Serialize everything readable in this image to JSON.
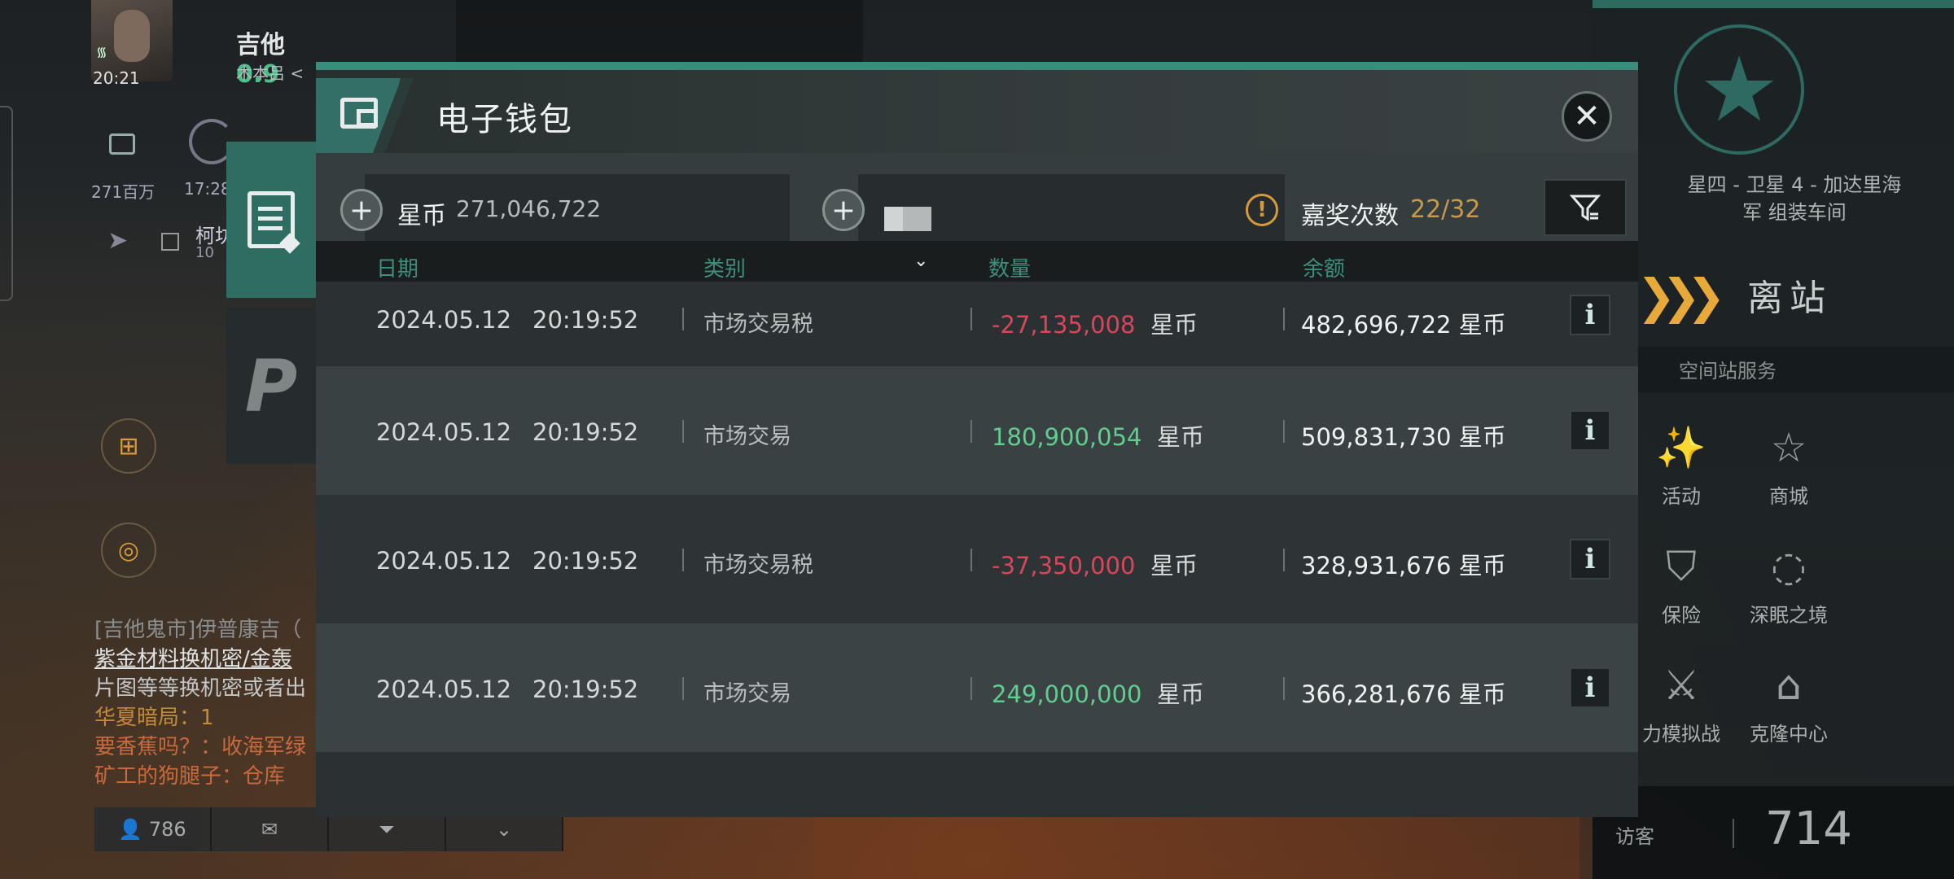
{
  "player": {
    "clock": "20:21",
    "name": "吉他",
    "security": "0.9",
    "corp": "木本吕 <",
    "isk_short": "271百万",
    "time_short": "17:28",
    "location_short": "柯坊",
    "location_sub": "10"
  },
  "chat": {
    "lines": [
      "[吉他鬼市]伊普康吉（",
      "紫金材料换机密/金轰",
      "片图等等换机密或者出",
      "华夏暗局：1",
      "要香蕉吗？：收海军绿",
      "矿工的狗腿子：仓库"
    ],
    "member_count": "786"
  },
  "station": {
    "name_line1": "星四 - 卫星 4 - 加达里海",
    "name_line2": "军 组装车间",
    "undock_label": "离站",
    "services_title": "空间站服务",
    "services": [
      {
        "label": "活动",
        "icon": "party-popper-icon"
      },
      {
        "label": "商城",
        "icon": "store-icon"
      },
      {
        "label": "保险",
        "icon": "insurance-icon"
      },
      {
        "label": "深眠之境",
        "icon": "deep-sleep-icon"
      },
      {
        "label": "力模拟战",
        "icon": "simulation-icon"
      },
      {
        "label": "克隆中心",
        "icon": "clone-center-icon"
      }
    ],
    "visitor_label": "访客",
    "visitor_count": "714"
  },
  "wallet": {
    "title": "电子钱包",
    "currency_label": "星币",
    "currency_value": "271,046,722",
    "bonus_label": "嘉奖次数",
    "bonus_value": "22/32",
    "columns": {
      "date": "日期",
      "category": "类别",
      "amount": "数量",
      "balance": "余额"
    },
    "rows": [
      {
        "date": "2024.05.12",
        "time": "20:19:52",
        "category": "市场交易税",
        "amount": "-27,135,008",
        "amount_sign": "neg",
        "unit": "星币",
        "balance": "482,696,722 星币"
      },
      {
        "date": "2024.05.12",
        "time": "20:19:52",
        "category": "市场交易",
        "amount": "180,900,054",
        "amount_sign": "pos",
        "unit": "星币",
        "balance": "509,831,730 星币"
      },
      {
        "date": "2024.05.12",
        "time": "20:19:52",
        "category": "市场交易税",
        "amount": "-37,350,000",
        "amount_sign": "neg",
        "unit": "星币",
        "balance": "328,931,676 星币"
      },
      {
        "date": "2024.05.12",
        "time": "20:19:52",
        "category": "市场交易",
        "amount": "249,000,000",
        "amount_sign": "pos",
        "unit": "星币",
        "balance": "366,281,676 星币"
      }
    ]
  },
  "colors": {
    "accent": "#3a8c7c",
    "negative": "#d9465a",
    "positive": "#5fce8e",
    "bonus": "#c79a4a",
    "warning": "#d79a3a"
  }
}
